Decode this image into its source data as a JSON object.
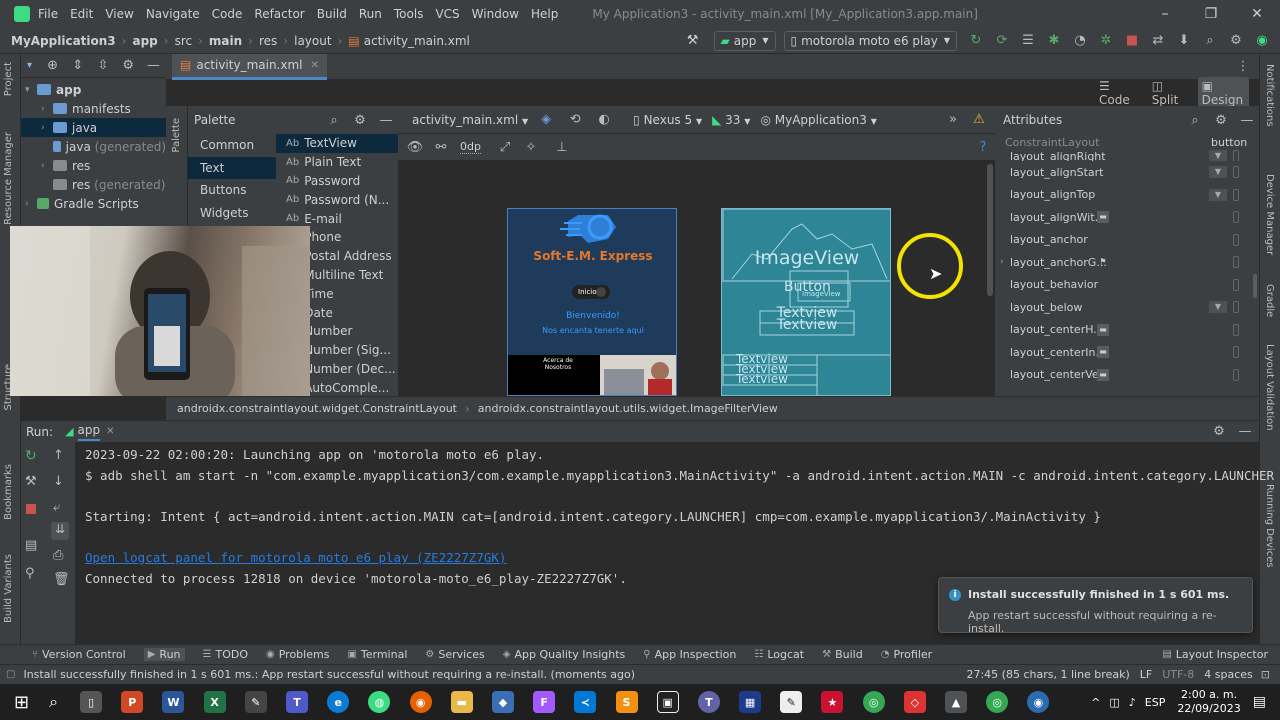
{
  "menu": {
    "items": [
      "File",
      "Edit",
      "View",
      "Navigate",
      "Code",
      "Refactor",
      "Build",
      "Run",
      "Tools",
      "VCS",
      "Window",
      "Help"
    ],
    "title": "My Application3 - activity_main.xml [My_Application3.app.main]"
  },
  "breadcrumb": [
    "MyApplication3",
    "app",
    "src",
    "main",
    "res",
    "layout",
    "activity_main.xml"
  ],
  "toolbar": {
    "run_config": "app",
    "device": "motorola moto e6 play"
  },
  "left_strip": {
    "project": "Project",
    "resource_manager": "Resource Manager",
    "structure": "Structure",
    "bookmarks": "Bookmarks",
    "build_variants": "Build Variants"
  },
  "right_strip": {
    "notifications": "Notifications",
    "device_manager": "Device Manager",
    "gradle": "Gradle",
    "layout_validation": "Layout Validation",
    "running_devices": "Running Devices"
  },
  "project_tree": [
    {
      "label": "app",
      "suffix": ""
    },
    {
      "label": "manifests",
      "suffix": ""
    },
    {
      "label": "java",
      "suffix": ""
    },
    {
      "label": "java",
      "suffix": "(generated)"
    },
    {
      "label": "res",
      "suffix": ""
    },
    {
      "label": "res",
      "suffix": "(generated)"
    },
    {
      "label": "Gradle Scripts",
      "suffix": ""
    }
  ],
  "editor_tab": "activity_main.xml",
  "view_modes": {
    "code": "Code",
    "split": "Split",
    "design": "Design"
  },
  "palette": {
    "title": "Palette",
    "side_label": "Palette",
    "categories": [
      "Common",
      "Text",
      "Buttons",
      "Widgets"
    ],
    "items": [
      "TextView",
      "Plain Text",
      "Password",
      "Password (N...",
      "E-mail",
      "Phone",
      "Postal Address",
      "Multiline Text",
      "Time",
      "Date",
      "Number",
      "Number (Sig...",
      "Number (Dec...",
      "AutoComple..."
    ],
    "item_prefix": "Ab"
  },
  "design_toolbar": {
    "file": "activity_main.xml",
    "device": "Nexus 5",
    "api": "33",
    "theme": "MyApplication3",
    "dp": "0dp"
  },
  "preview": {
    "app_name": "Soft-E.M. Express",
    "button": "Inicio",
    "welcome": "Bienvenido!",
    "subtitle": "Nos encanta tenerte aqui",
    "about": "Acerca de Nosotros"
  },
  "blueprint": {
    "image": "ImageView",
    "button": "Button",
    "image_small": "ImageView",
    "text1": "Textview",
    "text2": "Textview",
    "text3": "Textview",
    "text4": "Textview",
    "text5": "Textview"
  },
  "attributes": {
    "title": "Attributes",
    "component": "ConstraintLayout",
    "type": "button",
    "rows": [
      "layout_alignRight",
      "layout_alignStart",
      "layout_alignTop",
      "layout_alignWit...",
      "layout_anchor",
      "layout_anchorG...",
      "layout_behavior",
      "layout_below",
      "layout_centerH...",
      "layout_centerIn...",
      "layout_centerVe..."
    ]
  },
  "design_status": {
    "left": "androidx.constraintlayout.widget.ConstraintLayout",
    "right": "androidx.constraintlayout.utils.widget.ImageFilterView"
  },
  "run": {
    "label": "Run:",
    "config": "app",
    "lines": [
      "2023-09-22 02:00:20: Launching app on 'motorola moto e6 play.",
      "$ adb shell am start -n \"com.example.myapplication3/com.example.myapplication3.MainActivity\" -a android.intent.action.MAIN -c android.intent.category.LAUNCHER",
      "Starting: Intent { act=android.intent.action.MAIN cat=[android.intent.category.LAUNCHER] cmp=com.example.myapplication3/.MainActivity }",
      "Open logcat panel for motorola moto e6 play (ZE2227Z7GK)",
      "Connected to process 12818 on device 'motorola-moto_e6_play-ZE2227Z7GK'."
    ]
  },
  "notification": {
    "title": "Install successfully finished in 1 s 601 ms.",
    "body": "App restart successful without requiring a re-install."
  },
  "bottom_tabs": [
    "Version Control",
    "Run",
    "TODO",
    "Problems",
    "Terminal",
    "Services",
    "App Quality Insights",
    "App Inspection",
    "Logcat",
    "Build",
    "Profiler",
    "Layout Inspector"
  ],
  "status": {
    "message": "Install successfully finished in 1 s 601 ms.: App restart successful without requiring a re-install. (moments ago)",
    "position": "27:45 (85 chars, 1 line break)",
    "lf": "LF",
    "encoding": "UTF-8",
    "indent": "4 spaces"
  },
  "taskbar": {
    "lang": "ESP",
    "time": "2:00 a. m.",
    "date": "22/09/2023"
  }
}
